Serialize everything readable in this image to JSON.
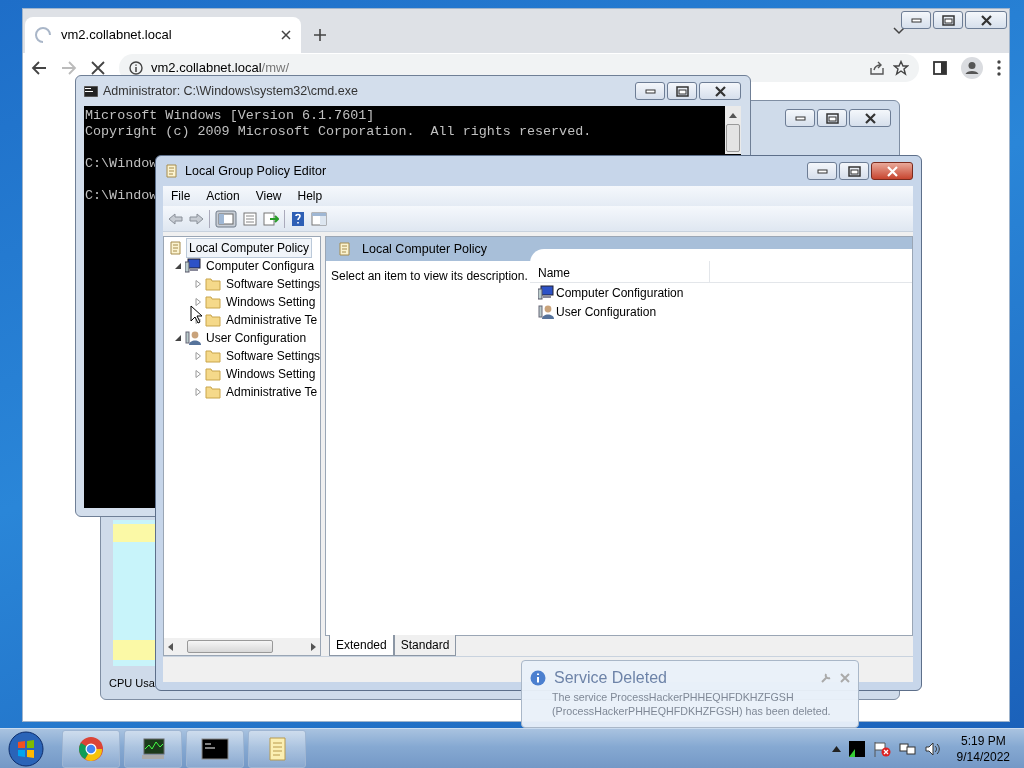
{
  "browser": {
    "tab_title": "vm2.collabnet.local",
    "loading": true,
    "url_host": "vm2.collabnet.local",
    "url_path": "/mw/"
  },
  "background_window": {
    "status_text": "CPU Usa"
  },
  "cmd": {
    "title": "Administrator: C:\\Windows\\system32\\cmd.exe",
    "blocks": [
      [
        "Microsoft Windows [Version 6.1.7601]",
        "Copyright (c) 2009 Microsoft Corporation.  All rights reserved."
      ],
      [
        "C:\\Window"
      ],
      [
        "C:\\Window"
      ]
    ]
  },
  "gpe": {
    "title": "Local Group Policy Editor",
    "menu": [
      "File",
      "Action",
      "View",
      "Help"
    ],
    "tree": {
      "label": "Local Computer Policy",
      "kind": "policy",
      "selected": true,
      "children": [
        {
          "label": "Computer Configura",
          "kind": "computer",
          "selected": false,
          "expanded": true,
          "children": [
            {
              "label": "Software Settings",
              "kind": "folder",
              "selected": false,
              "expanded": false
            },
            {
              "label": "Windows Setting",
              "kind": "folder",
              "selected": false,
              "expanded": false
            },
            {
              "label": "Administrative Te",
              "kind": "folder",
              "selected": false,
              "expanded": false
            }
          ]
        },
        {
          "label": "User Configuration",
          "kind": "user",
          "selected": false,
          "expanded": true,
          "children": [
            {
              "label": "Software Settings",
              "kind": "folder",
              "selected": false,
              "expanded": false
            },
            {
              "label": "Windows Setting",
              "kind": "folder",
              "selected": false,
              "expanded": false
            },
            {
              "label": "Administrative Te",
              "kind": "folder",
              "selected": false,
              "expanded": false
            }
          ]
        }
      ]
    },
    "pane_header": "Local Computer Policy",
    "description": "Select an item to view its description.",
    "list_column": "Name",
    "list_items": [
      {
        "label": "Computer Configuration",
        "kind": "computer"
      },
      {
        "label": "User Configuration",
        "kind": "user"
      }
    ],
    "tabs": [
      {
        "label": "Extended",
        "selected": true
      },
      {
        "label": "Standard",
        "selected": false
      }
    ]
  },
  "notification": {
    "title": "Service Deleted",
    "message": "The service ProcessHackerPHHEQHFDKHZFGSH (ProcessHackerPHHEQHFDKHZFGSH) has been deleted."
  },
  "taskbar": {
    "clock_time": "5:19 PM",
    "clock_date": "9/14/2022"
  }
}
